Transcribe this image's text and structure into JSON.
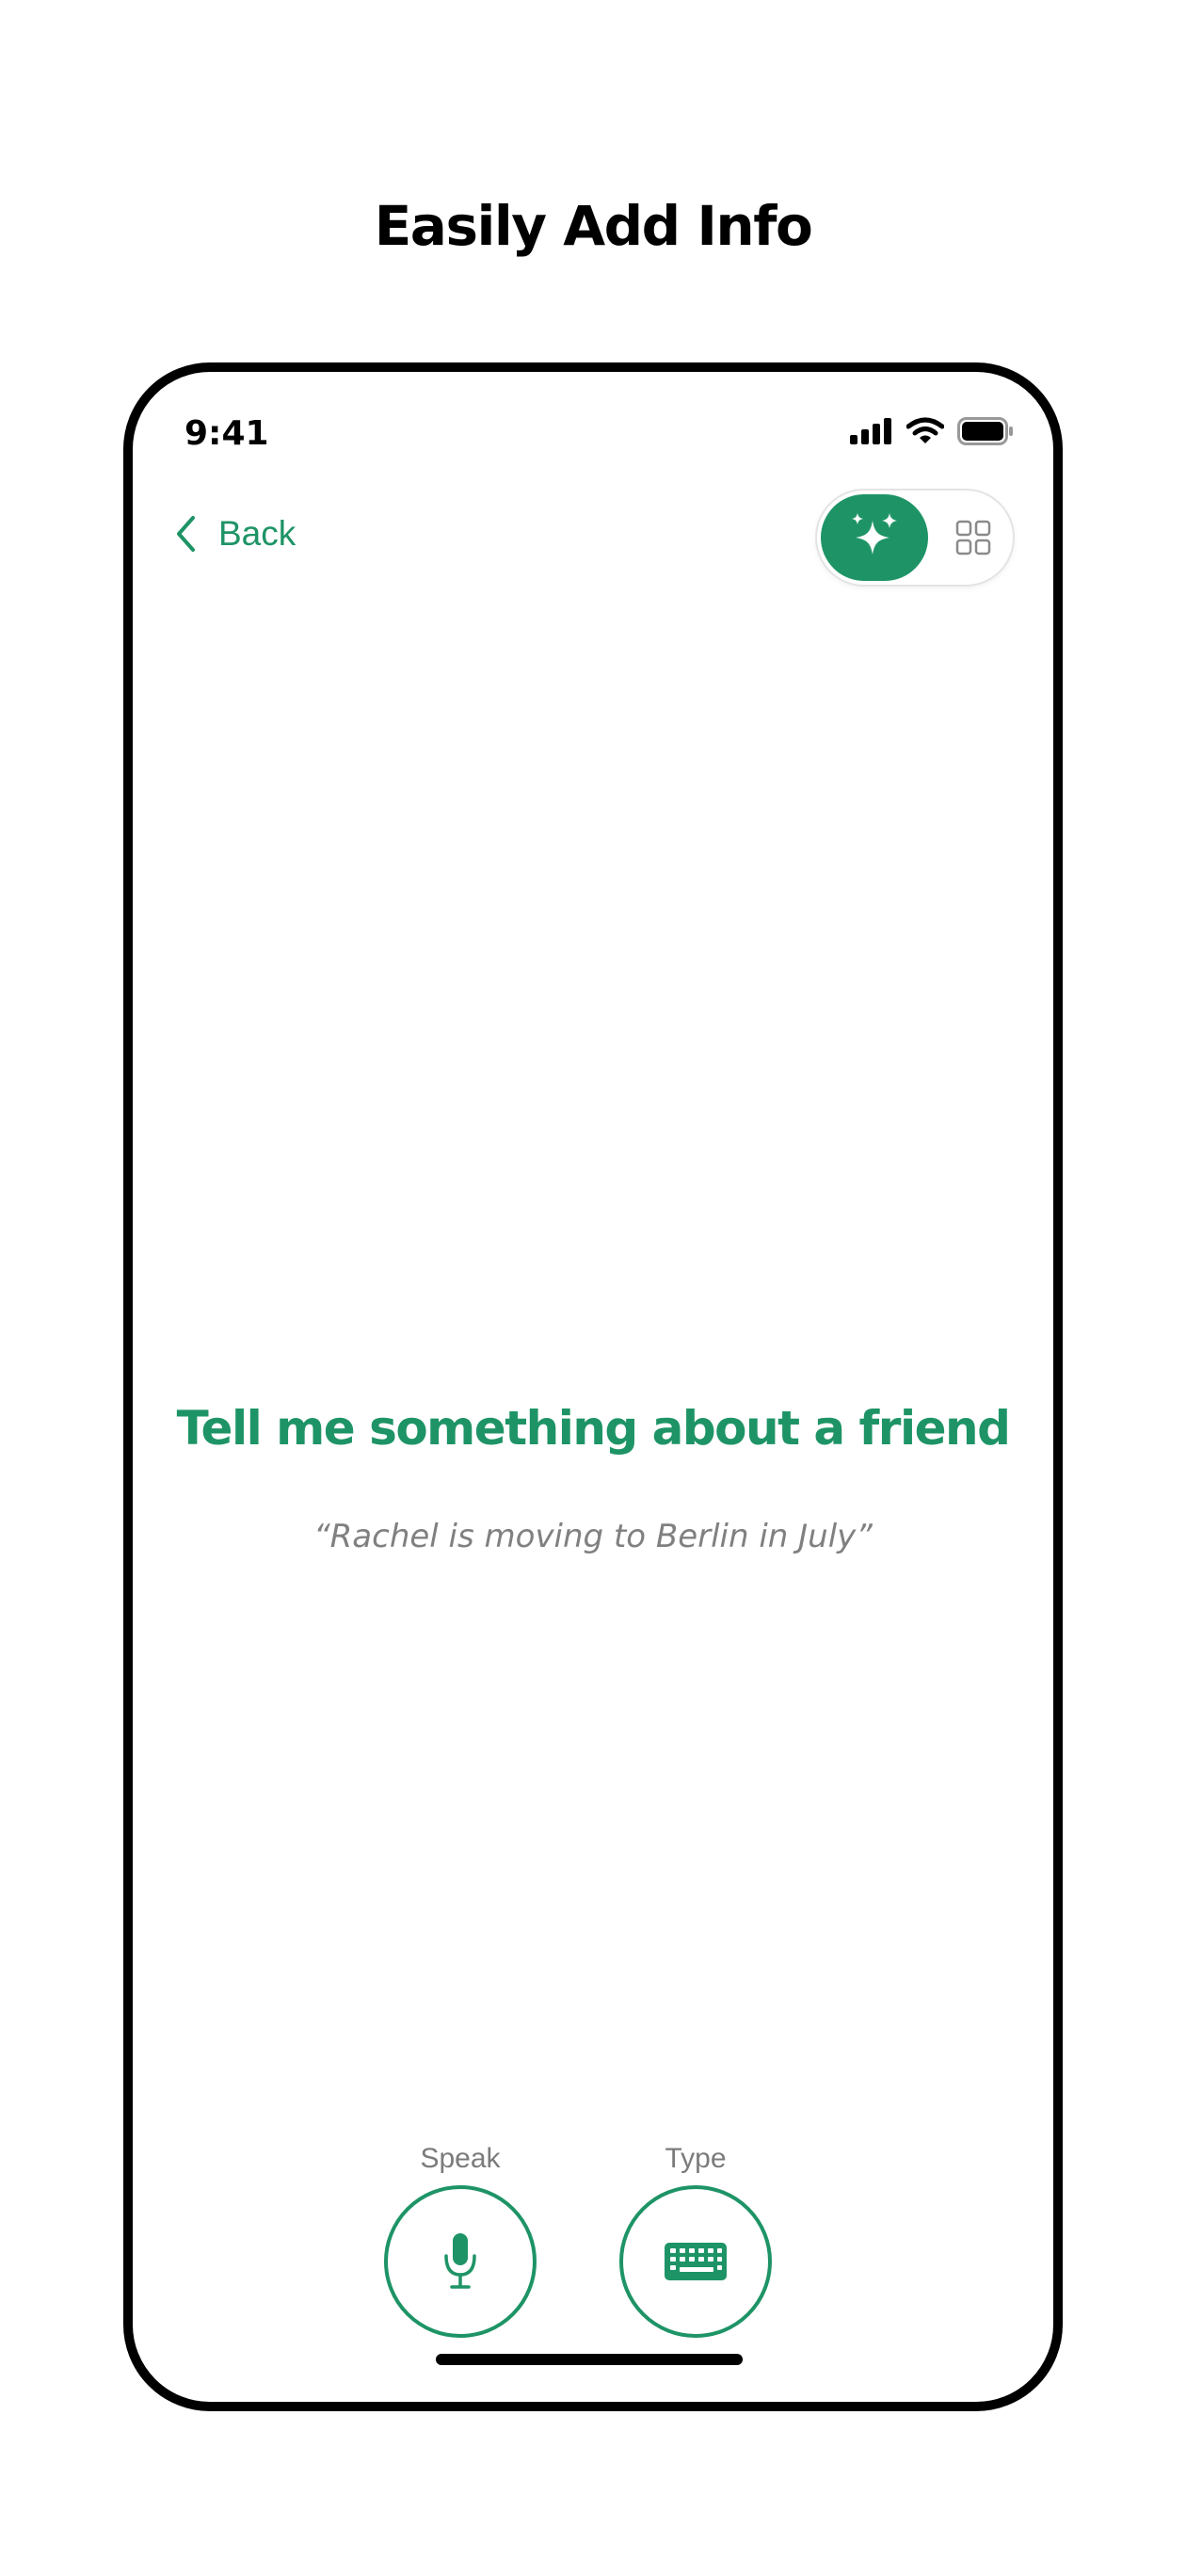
{
  "headline": "Easily Add Info",
  "status_bar": {
    "time": "9:41"
  },
  "nav": {
    "back_label": "Back"
  },
  "mode_toggle": {
    "selected": "ai",
    "options": [
      "sparkles-icon",
      "grid-icon"
    ]
  },
  "prompt": {
    "title": "Tell me something about a friend",
    "example": "“Rachel is moving to Berlin in July”"
  },
  "actions": {
    "speak_label": "Speak",
    "type_label": "Type"
  },
  "colors": {
    "accent": "#1e9466",
    "secondary_text": "#808080"
  }
}
